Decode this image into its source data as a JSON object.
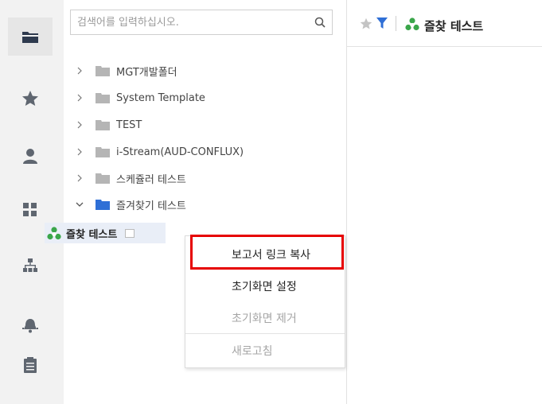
{
  "search": {
    "placeholder": "검색어를 입력하십시오."
  },
  "tree": {
    "items": [
      {
        "label": "MGT개발폴더",
        "expanded": false
      },
      {
        "label": "System Template",
        "expanded": false
      },
      {
        "label": "TEST",
        "expanded": false
      },
      {
        "label": "i-Stream(AUD-CONFLUX)",
        "expanded": false
      },
      {
        "label": "스케쥴러 테스트",
        "expanded": false
      },
      {
        "label": "즐겨찾기 테스트",
        "expanded": true
      }
    ],
    "selected_child": {
      "label": "즐찾 테스트"
    }
  },
  "context_menu": {
    "items": [
      {
        "label": "보고서 링크 복사",
        "enabled": true
      },
      {
        "label": "초기화면 설정",
        "enabled": true
      },
      {
        "label": "초기화면 제거",
        "enabled": false
      },
      {
        "label": "새로고침",
        "enabled": false
      }
    ]
  },
  "header": {
    "report_title": "즐찾 테스트"
  },
  "colors": {
    "accent_blue": "#2f6fd6",
    "folder_gray": "#b5b5b5",
    "report_green": "#3aa64a",
    "highlight_red": "#e60000"
  }
}
